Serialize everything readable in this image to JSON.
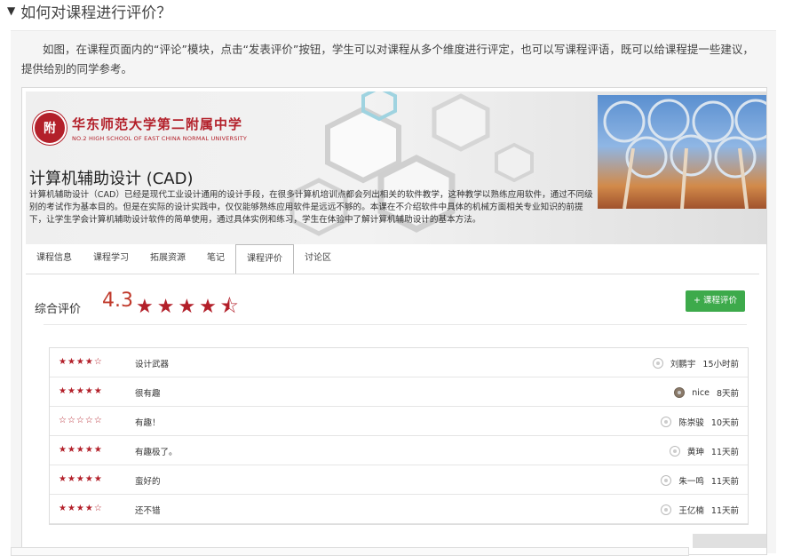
{
  "faq": {
    "question": "如何对课程进行评价？",
    "answer_text": "如图，在课程页面内的“评论”模块，点击“发表评价”按钮，学生可以对课程从多个维度进行评定，也可以写课程评语，既可以给课程提一些建议，提供给别的同学参考。"
  },
  "school": {
    "name_cn": "华东师范大学第二附属中学",
    "name_en": "NO.2 HIGH SCHOOL OF EAST CHINA NORMAL UNIVERSITY"
  },
  "course": {
    "title": "计算机辅助设计 (CAD)",
    "description": "计算机辅助设计（CAD）已经是现代工业设计通用的设计手段，在很多计算机培训点都会列出相关的软件教学，这种教学以熟练应用软件，通过不同级别的考试作为基本目的。但是在实际的设计实践中，仅仅能够熟练应用软件是远远不够的。本课在不介绍软件中具体的机械方面相关专业知识的前提下，让学生学会计算机辅助设计软件的简单使用，通过具体实例和练习，学生在体验中了解计算机辅助设计的基本方法。"
  },
  "tabs": [
    {
      "label": "课程信息",
      "active": false
    },
    {
      "label": "课程学习",
      "active": false
    },
    {
      "label": "拓展资源",
      "active": false
    },
    {
      "label": "笔记",
      "active": false
    },
    {
      "label": "课程评价",
      "active": true
    },
    {
      "label": "讨论区",
      "active": false
    }
  ],
  "rating": {
    "label": "综合评价",
    "score": "4.3",
    "stars_display": "★★★★⯪",
    "button_label": "+ 课程评价"
  },
  "reviews": [
    {
      "stars": "★★★★☆",
      "rating": 4,
      "comment": "设计武器",
      "author": "刘鹏宇",
      "time": "15小时前"
    },
    {
      "stars": "★★★★★",
      "rating": 5,
      "comment": "很有趣",
      "author": "nice",
      "time": "8天前"
    },
    {
      "stars": "☆☆☆☆☆",
      "rating": 0,
      "comment": "有趣！",
      "author": "陈崇骏",
      "time": "10天前"
    },
    {
      "stars": "★★★★★",
      "rating": 5,
      "comment": "有趣极了。",
      "author": "黄珅",
      "time": "11天前"
    },
    {
      "stars": "★★★★★",
      "rating": 5,
      "comment": "蛮好的",
      "author": "朱一鸣",
      "time": "11天前"
    },
    {
      "stars": "★★★★☆",
      "rating": 4,
      "comment": "还不错",
      "author": "王亿楠",
      "time": "11天前"
    }
  ],
  "colors": {
    "accent_red": "#b3202a",
    "button_green": "#3daa4b"
  }
}
